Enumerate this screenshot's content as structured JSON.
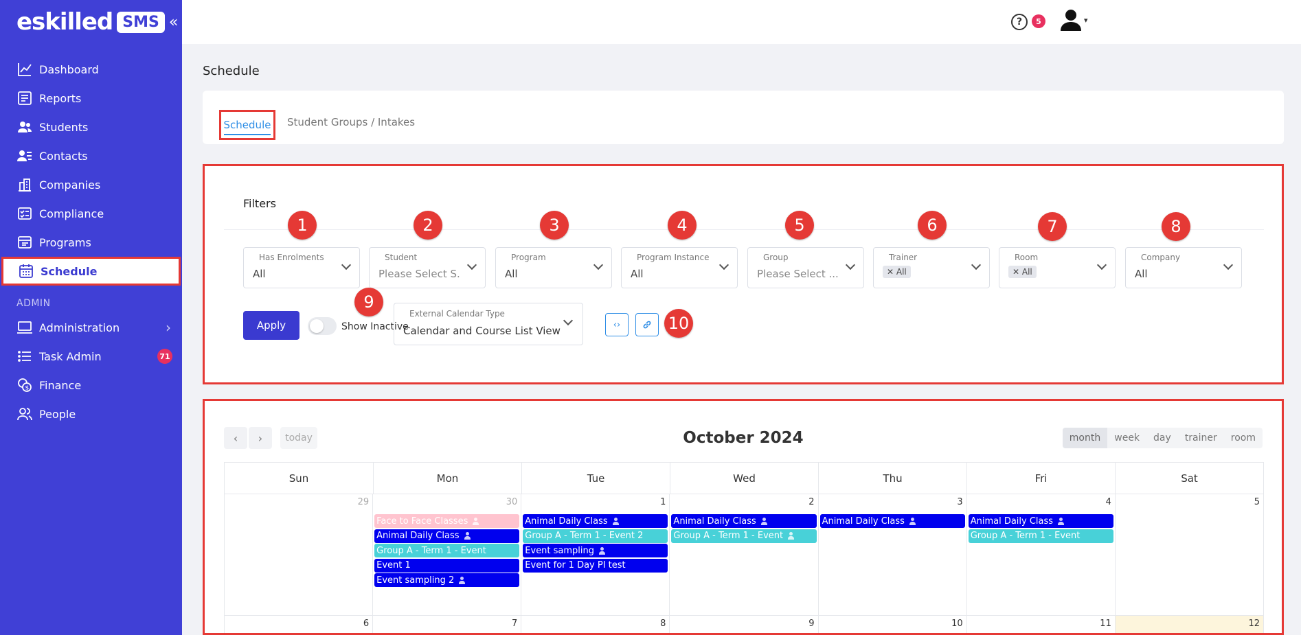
{
  "brand": {
    "name": "eskilled",
    "badge": "SMS",
    "collapse": "«"
  },
  "sidebar": {
    "items": [
      {
        "label": "Dashboard",
        "icon": "chart-line-icon"
      },
      {
        "label": "Reports",
        "icon": "report-icon"
      },
      {
        "label": "Students",
        "icon": "students-icon"
      },
      {
        "label": "Contacts",
        "icon": "contacts-icon"
      },
      {
        "label": "Companies",
        "icon": "building-icon"
      },
      {
        "label": "Compliance",
        "icon": "checklist-icon"
      },
      {
        "label": "Programs",
        "icon": "programs-icon"
      },
      {
        "label": "Schedule",
        "icon": "calendar-icon",
        "active": true
      }
    ],
    "section": "ADMIN",
    "admin_items": [
      {
        "label": "Administration",
        "icon": "monitor-icon"
      },
      {
        "label": "Task Admin",
        "icon": "list-icon",
        "badge": "71"
      },
      {
        "label": "Finance",
        "icon": "coins-icon"
      },
      {
        "label": "People",
        "icon": "people-icon"
      }
    ]
  },
  "topbar": {
    "help": "?",
    "notifications": "5"
  },
  "page": {
    "title": "Schedule"
  },
  "tabs": [
    "Schedule",
    "Student Groups / Intakes"
  ],
  "filters": {
    "title": "Filters",
    "fields": [
      {
        "label": "Has Enrolments",
        "value": "All"
      },
      {
        "label": "Student",
        "value": "Please Select S..."
      },
      {
        "label": "Program",
        "value": "All"
      },
      {
        "label": "Program Instance",
        "value": "All"
      },
      {
        "label": "Group",
        "value": "Please Select ..."
      },
      {
        "label": "Trainer",
        "value": "All"
      },
      {
        "label": "Room",
        "value": "All"
      },
      {
        "label": "Company",
        "value": "All"
      }
    ],
    "apply": "Apply",
    "show_inactive": "Show Inactive",
    "ext_calendar_label": "External Calendar Type",
    "ext_calendar_value": "Calendar and Course List View",
    "embed_icon": "‹›",
    "link_icon": "🔗"
  },
  "markers": [
    "1",
    "2",
    "3",
    "4",
    "5",
    "6",
    "7",
    "8",
    "9",
    "10"
  ],
  "calendar": {
    "title": "October 2024",
    "prev": "‹",
    "next": "›",
    "today": "today",
    "views": [
      "month",
      "week",
      "day",
      "trainer",
      "room"
    ],
    "weekdays": [
      "Sun",
      "Mon",
      "Tue",
      "Wed",
      "Thu",
      "Fri",
      "Sat"
    ],
    "week1_days": [
      "29",
      "30",
      "1",
      "2",
      "3",
      "4",
      "5"
    ],
    "week2_days": [
      "6",
      "7",
      "8",
      "9",
      "10",
      "11",
      "12"
    ],
    "events": {
      "mon": [
        {
          "title": "Face to Face Classes",
          "color": "pink"
        },
        {
          "title": "Animal Daily Class",
          "color": "blue"
        },
        {
          "title": "Group A - Term 1 - Event",
          "color": "teal"
        },
        {
          "title": "Event 1",
          "color": "blue"
        },
        {
          "title": "Event sampling 2",
          "color": "blue"
        }
      ],
      "tue": [
        {
          "title": "Animal Daily Class",
          "color": "blue"
        },
        {
          "title": "Group A - Term 1 - Event 2",
          "color": "teal"
        },
        {
          "title": "Event sampling",
          "color": "blue"
        },
        {
          "title": "Event for 1 Day PI test",
          "color": "blue"
        }
      ],
      "wed": [
        {
          "title": "Animal Daily Class",
          "color": "blue"
        },
        {
          "title": "Group A - Term 1 - Event",
          "color": "teal"
        }
      ],
      "thu": [
        {
          "title": "Animal Daily Class",
          "color": "blue"
        }
      ],
      "fri": [
        {
          "title": "Animal Daily Class",
          "color": "blue"
        },
        {
          "title": "Group A - Term 1 - Event",
          "color": "teal"
        }
      ]
    }
  }
}
